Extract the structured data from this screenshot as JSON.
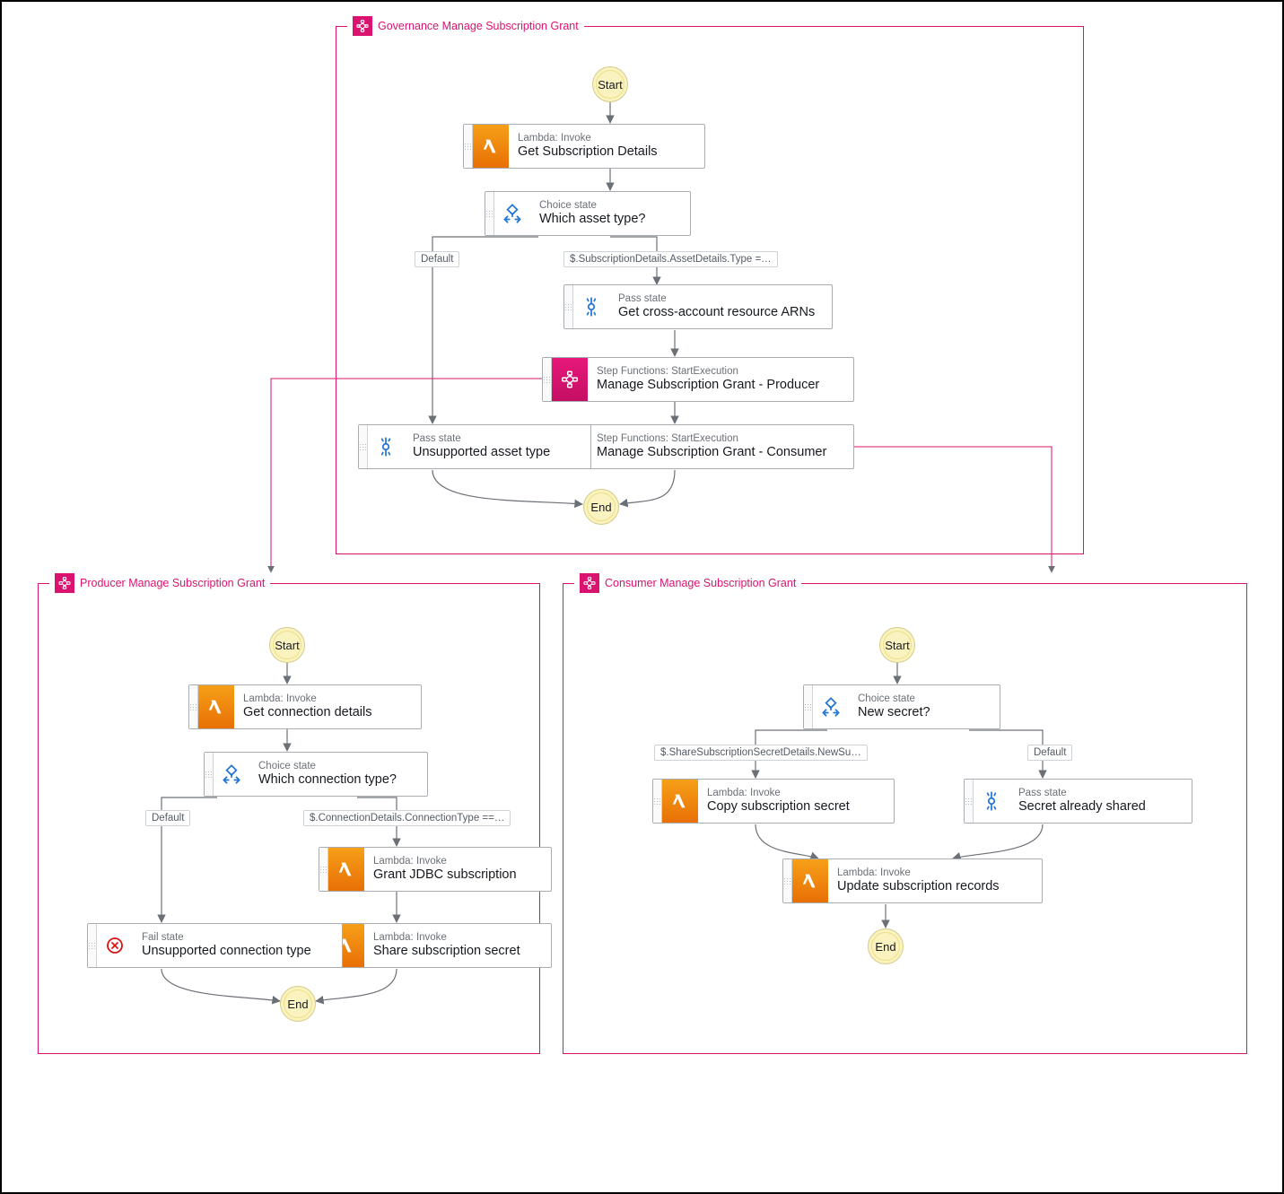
{
  "colors": {
    "panel_border": "#d9136f",
    "lambda_bg": "#ed7615",
    "sf_bg": "#d21670",
    "neutral": "#545b64"
  },
  "panels": {
    "governance": {
      "title": "Governance Manage Subscription Grant"
    },
    "producer": {
      "title": "Producer Manage Subscription Grant"
    },
    "consumer": {
      "title": "Consumer Manage Subscription Grant"
    }
  },
  "terminals": {
    "start": "Start",
    "end": "End"
  },
  "states": {
    "lambda": "Lambda: Invoke",
    "choice": "Choice state",
    "pass": "Pass state",
    "fail": "Fail state",
    "sfn": "Step Functions: StartExecution"
  },
  "labels": {
    "default": "Default",
    "asset_type_cond": "$.SubscriptionDetails.AssetDetails.Type =…",
    "connection_type_cond": "$.ConnectionDetails.ConnectionType ==…",
    "new_secret_cond": "$.ShareSubscriptionSecretDetails.NewSu…"
  },
  "nodes": {
    "get_sub_details": "Get Subscription Details",
    "which_asset_type": "Which asset type?",
    "get_cross_arns": "Get cross-account resource ARNs",
    "manage_grant_producer": "Manage Subscription Grant - Producer",
    "manage_grant_consumer": "Manage Subscription Grant - Consumer",
    "unsupported_asset_type": "Unsupported asset type",
    "get_conn_details": "Get connection details",
    "which_conn_type": "Which connection type?",
    "grant_jdbc": "Grant JDBC subscription",
    "share_sub_secret": "Share subscription secret",
    "unsupported_conn_type": "Unsupported connection type",
    "new_secret_q": "New secret?",
    "copy_sub_secret": "Copy subscription secret",
    "secret_already_shared": "Secret already shared",
    "update_sub_records": "Update subscription records"
  }
}
